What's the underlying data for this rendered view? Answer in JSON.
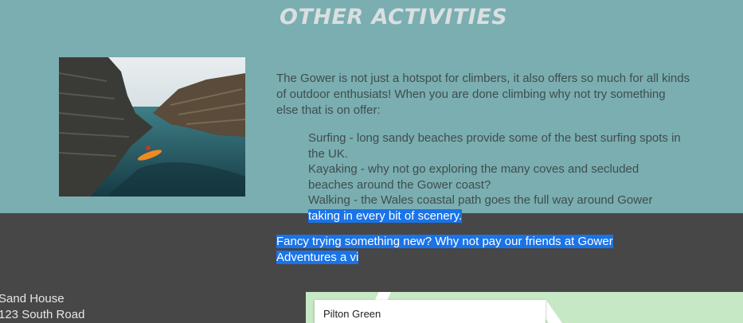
{
  "section": {
    "title": "OTHER ACTIVITIES",
    "intro": "The Gower is not just a hotspot for climbers, it also offers so much for all kinds of outdoor enthusiats! When you are done climbing why not try something else that is on offer:",
    "activities": [
      {
        "text": "Surfing - long sandy beaches provide some of the best surfing spots in the UK."
      },
      {
        "text": "Kayaking - why not go exploring the many coves and secluded beaches around the Gower coast?"
      },
      {
        "text_plain": "Walking - the Wales coastal path goes the full way around Gower ",
        "text_selected": "taking in every bit of scenery."
      }
    ],
    "cta_selected": "Fancy trying something new? Why not pay our friends at Gower Adventures a vi",
    "image_icon": "kayak-photo"
  },
  "footer": {
    "address_line1": "Sand House",
    "address_line2": "123 South Road",
    "map_place": "Pilton Green"
  },
  "colors": {
    "teal_bg": "#7aaeb0",
    "dark_bg": "#474747",
    "selection": "#1a73e8",
    "title": "#d9dfe0",
    "body_text": "#3f4d4f"
  }
}
